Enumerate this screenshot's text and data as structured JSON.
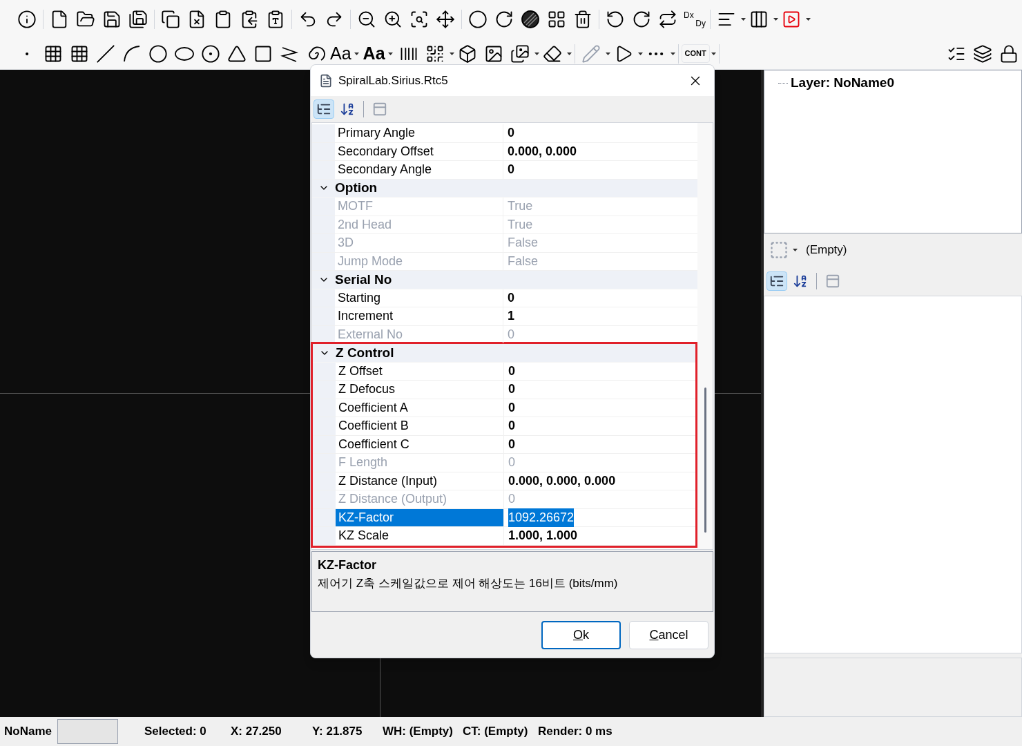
{
  "toolbar_top": {
    "dxdy": [
      "Dx",
      "Dy"
    ]
  },
  "toolbar_bottom": {
    "font_buttons": [
      {
        "label": "Aa",
        "bold": false
      },
      {
        "label": "Aa",
        "bold": true
      }
    ],
    "cont": "CONT"
  },
  "dialog": {
    "title": "SpiralLab.Sirius.Rtc5",
    "toolbar": [
      {
        "kind": "categorized",
        "selected": true
      },
      {
        "kind": "alphabetical",
        "selected": false
      },
      {
        "kind": "pages",
        "selected": false
      }
    ],
    "rows": [
      {
        "kind": "property",
        "name": "Primary Angle",
        "value": "0",
        "disabled": false,
        "selected": false,
        "annotated": false
      },
      {
        "kind": "property",
        "name": "Secondary Offset",
        "value": "0.000, 0.000",
        "disabled": false,
        "selected": false,
        "annotated": false
      },
      {
        "kind": "property",
        "name": "Secondary Angle",
        "value": "0",
        "disabled": false,
        "selected": false,
        "annotated": false
      },
      {
        "kind": "category",
        "name": "Option",
        "expanded": true,
        "annotated": false
      },
      {
        "kind": "property",
        "name": "MOTF",
        "value": "True",
        "disabled": true,
        "selected": false,
        "annotated": false
      },
      {
        "kind": "property",
        "name": "2nd Head",
        "value": "True",
        "disabled": true,
        "selected": false,
        "annotated": false
      },
      {
        "kind": "property",
        "name": "3D",
        "value": "False",
        "disabled": true,
        "selected": false,
        "annotated": false
      },
      {
        "kind": "property",
        "name": "Jump Mode",
        "value": "False",
        "disabled": true,
        "selected": false,
        "annotated": false
      },
      {
        "kind": "category",
        "name": "Serial No",
        "expanded": true,
        "annotated": false
      },
      {
        "kind": "property",
        "name": "Starting",
        "value": "0",
        "disabled": false,
        "selected": false,
        "annotated": false
      },
      {
        "kind": "property",
        "name": "Increment",
        "value": "1",
        "disabled": false,
        "selected": false,
        "annotated": false
      },
      {
        "kind": "property",
        "name": "External No",
        "value": "0",
        "disabled": true,
        "selected": false,
        "annotated": false
      },
      {
        "kind": "category",
        "name": "Z Control",
        "expanded": true,
        "annotated": true
      },
      {
        "kind": "property",
        "name": "Z Offset",
        "value": "0",
        "disabled": false,
        "selected": false,
        "annotated": true
      },
      {
        "kind": "property",
        "name": "Z Defocus",
        "value": "0",
        "disabled": false,
        "selected": false,
        "annotated": true
      },
      {
        "kind": "property",
        "name": "Coefficient A",
        "value": "0",
        "disabled": false,
        "selected": false,
        "annotated": true
      },
      {
        "kind": "property",
        "name": "Coefficient B",
        "value": "0",
        "disabled": false,
        "selected": false,
        "annotated": true
      },
      {
        "kind": "property",
        "name": "Coefficient C",
        "value": "0",
        "disabled": false,
        "selected": false,
        "annotated": true
      },
      {
        "kind": "property",
        "name": "F Length",
        "value": "0",
        "disabled": true,
        "selected": false,
        "annotated": true
      },
      {
        "kind": "property",
        "name": "Z Distance (Input)",
        "value": "0.000, 0.000, 0.000",
        "disabled": false,
        "selected": false,
        "annotated": true
      },
      {
        "kind": "property",
        "name": "Z Distance (Output)",
        "value": "0",
        "disabled": true,
        "selected": false,
        "annotated": true
      },
      {
        "kind": "property",
        "name": "KZ-Factor",
        "value": "1092.26672",
        "disabled": false,
        "selected": true,
        "annotated": true
      },
      {
        "kind": "property",
        "name": "KZ Scale",
        "value": "1.000, 1.000",
        "disabled": false,
        "selected": false,
        "annotated": true
      }
    ],
    "description": {
      "title": "KZ-Factor",
      "text": "제어기 Z축 스케일값으로 제어 해상도는 16비트 (bits/mm)"
    },
    "buttons": [
      {
        "label": "Ok",
        "default": true
      },
      {
        "label": "Cancel",
        "default": false
      }
    ]
  },
  "right_panel": {
    "tree": [
      {
        "label": "Layer: NoName0"
      }
    ],
    "selection": "(Empty)",
    "toolbar": [
      {
        "kind": "categorized",
        "selected": true
      },
      {
        "kind": "alphabetical",
        "selected": false
      },
      {
        "kind": "pages",
        "selected": false
      }
    ]
  },
  "status_bar": {
    "name": "NoName",
    "items": [
      "Selected: 0",
      "X: 27.250",
      "Y: 21.875",
      "WH: (Empty)",
      "CT: (Empty)",
      "Render: 0 ms"
    ]
  }
}
